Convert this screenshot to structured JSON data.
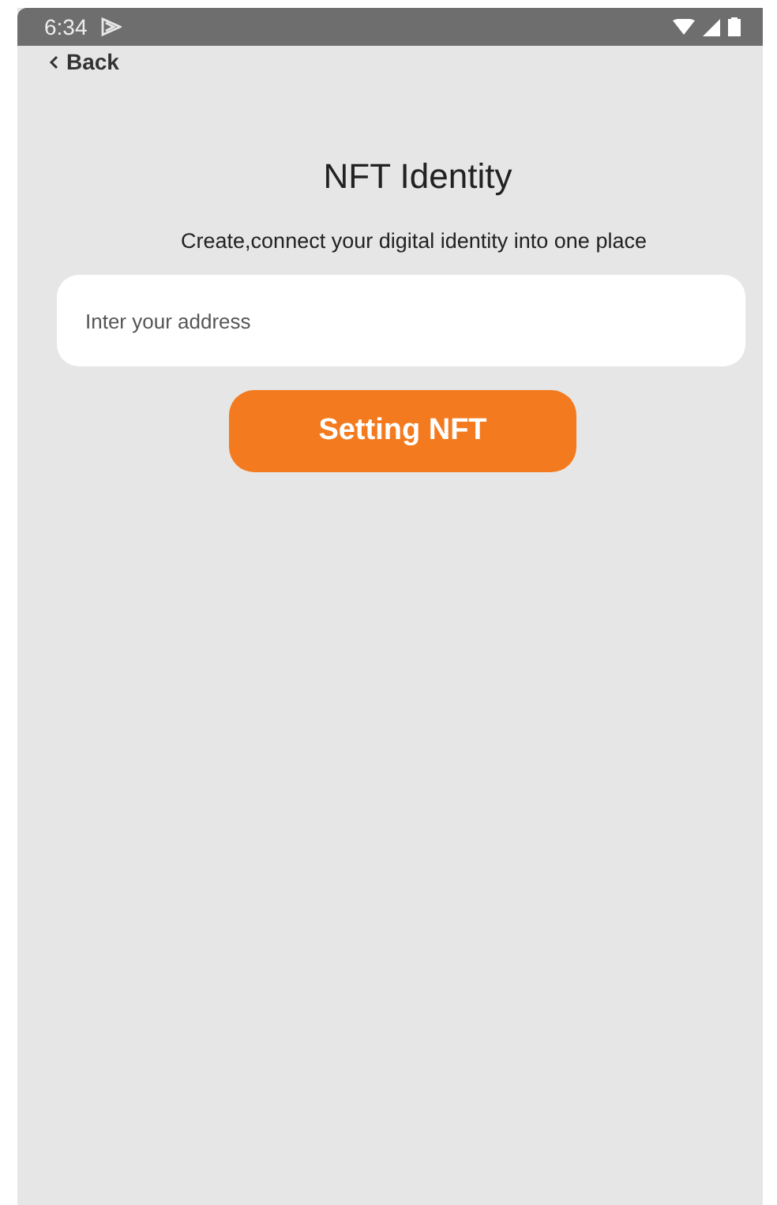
{
  "status_bar": {
    "time": "6:34"
  },
  "nav": {
    "back_label": "Back"
  },
  "title": "NFT Identity",
  "subtitle": "Create,connect your digital identity into one place",
  "address_field": {
    "placeholder": "Inter your address"
  },
  "submit_button": {
    "label": "Setting NFT"
  }
}
